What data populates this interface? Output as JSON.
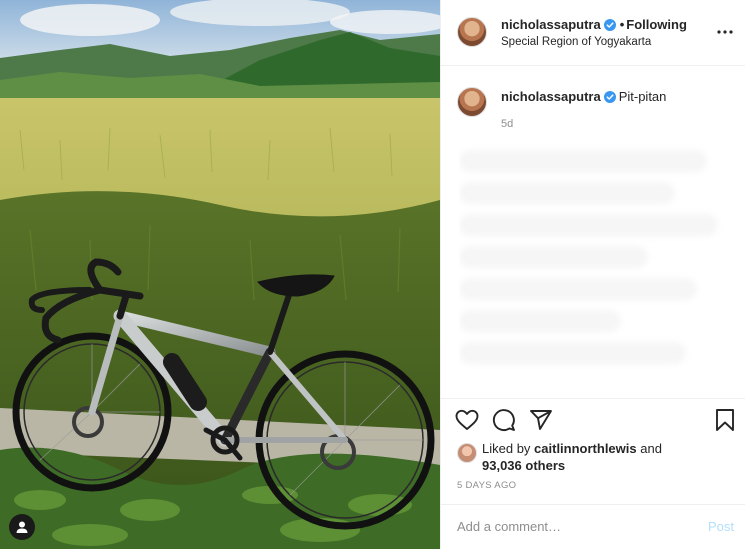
{
  "post": {
    "username": "nicholassaputra",
    "verified": true,
    "separator": "•",
    "follow_status": "Following",
    "location": "Special Region of Yogyakarta",
    "more_icon": "more-horizontal-icon"
  },
  "caption": {
    "username": "nicholassaputra",
    "text": "Pit-pitan",
    "age": "5d"
  },
  "actions": {
    "like_icon": "heart-icon",
    "comment_icon": "comment-icon",
    "share_icon": "paper-plane-icon",
    "save_icon": "bookmark-icon"
  },
  "likes": {
    "prefix": "Liked by",
    "liker": "caitlinnorthlewis",
    "joiner": "and",
    "others": "93,036 others"
  },
  "timestamp": "5 DAYS AGO",
  "comment": {
    "placeholder": "Add a comment…",
    "post_label": "Post"
  },
  "colors": {
    "verified_blue": "#3897f0",
    "post_button_disabled": "#b2dffc",
    "muted_text": "#8e8e8e"
  }
}
